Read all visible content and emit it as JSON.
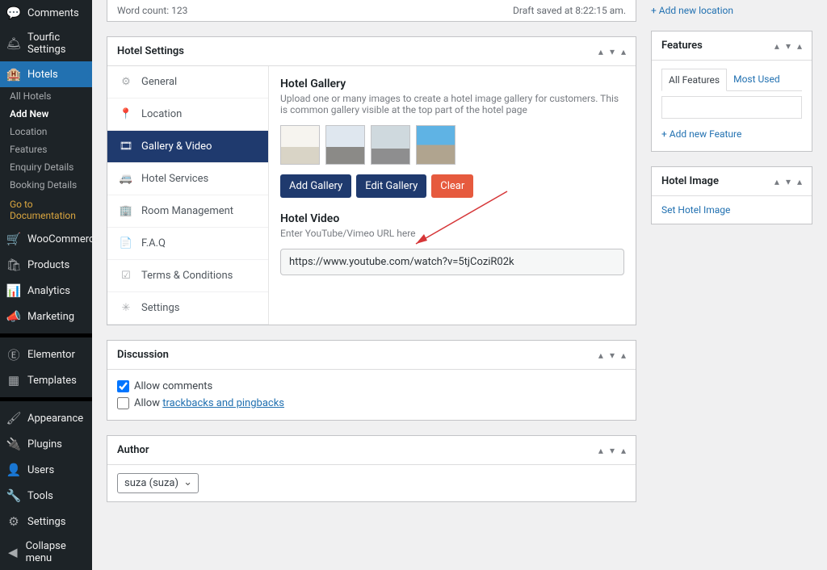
{
  "sidebar": {
    "items_top": [
      {
        "icon": "💬",
        "label": "Comments"
      },
      {
        "icon": "🛎",
        "label": "Tourfic Settings"
      }
    ],
    "hotels": {
      "icon": "🏨",
      "label": "Hotels"
    },
    "subitems": [
      {
        "label": "All Hotels",
        "active": false
      },
      {
        "label": "Add New",
        "active": true
      },
      {
        "label": "Location",
        "active": false
      },
      {
        "label": "Features",
        "active": false
      },
      {
        "label": "Enquiry Details",
        "active": false
      },
      {
        "label": "Booking Details",
        "active": false
      }
    ],
    "doc": "Go to Documentation",
    "items_bottom": [
      {
        "icon": "🛒",
        "label": "WooCommerce"
      },
      {
        "icon": "🛍",
        "label": "Products"
      },
      {
        "icon": "📊",
        "label": "Analytics"
      },
      {
        "icon": "📣",
        "label": "Marketing"
      }
    ],
    "items_bottom2": [
      {
        "icon": "Ⓔ",
        "label": "Elementor"
      },
      {
        "icon": "▦",
        "label": "Templates"
      }
    ],
    "items_bottom3": [
      {
        "icon": "🖌",
        "label": "Appearance"
      },
      {
        "icon": "🔌",
        "label": "Plugins"
      },
      {
        "icon": "👤",
        "label": "Users"
      },
      {
        "icon": "🔧",
        "label": "Tools"
      },
      {
        "icon": "⚙",
        "label": "Settings"
      },
      {
        "icon": "◀",
        "label": "Collapse menu"
      }
    ]
  },
  "status": {
    "word_count": "Word count: 123",
    "draft": "Draft saved at 8:22:15 am."
  },
  "hotel_settings": {
    "title": "Hotel Settings",
    "tabs": [
      {
        "icon": "⚙",
        "label": "General"
      },
      {
        "icon": "📍",
        "label": "Location"
      },
      {
        "icon": "🎞",
        "label": "Gallery & Video"
      },
      {
        "icon": "🚐",
        "label": "Hotel Services"
      },
      {
        "icon": "🏢",
        "label": "Room Management"
      },
      {
        "icon": "📄",
        "label": "F.A.Q"
      },
      {
        "icon": "☑",
        "label": "Terms & Conditions"
      },
      {
        "icon": "✳",
        "label": "Settings"
      }
    ],
    "gallery": {
      "title": "Hotel Gallery",
      "desc": "Upload one or many images to create a hotel image gallery for customers. This is common gallery visible at the top part of the hotel page",
      "btn_add": "Add Gallery",
      "btn_edit": "Edit Gallery",
      "btn_clear": "Clear"
    },
    "video": {
      "title": "Hotel Video",
      "desc": "Enter YouTube/Vimeo URL here",
      "value": "https://www.youtube.com/watch?v=5tjCoziR02k"
    }
  },
  "discussion": {
    "title": "Discussion",
    "allow_comments": "Allow comments",
    "allow_prefix": "Allow ",
    "trackbacks": "trackbacks and pingbacks"
  },
  "author": {
    "title": "Author",
    "value": "suza (suza)"
  },
  "side_top": {
    "add_location": "+ Add new location"
  },
  "features": {
    "title": "Features",
    "tab_all": "All Features",
    "tab_used": "Most Used",
    "add": "+ Add new Feature"
  },
  "hotel_image": {
    "title": "Hotel Image",
    "link": "Set Hotel Image"
  }
}
